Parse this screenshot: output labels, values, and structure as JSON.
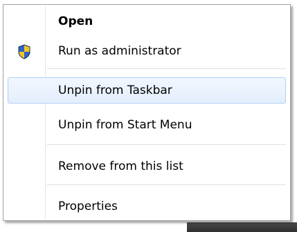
{
  "menu": {
    "items": [
      {
        "label": "Open",
        "bold": true
      },
      {
        "label": "Run as administrator",
        "icon": "uac-shield-icon"
      },
      {
        "label": "Unpin from Taskbar",
        "highlighted": true
      },
      {
        "label": "Unpin from Start Menu"
      },
      {
        "label": "Remove from this list"
      },
      {
        "label": "Properties"
      }
    ]
  },
  "colors": {
    "highlight_border": "#aecff7",
    "highlight_fill": "#e3eefc",
    "menu_border": "#a0a0a0"
  }
}
